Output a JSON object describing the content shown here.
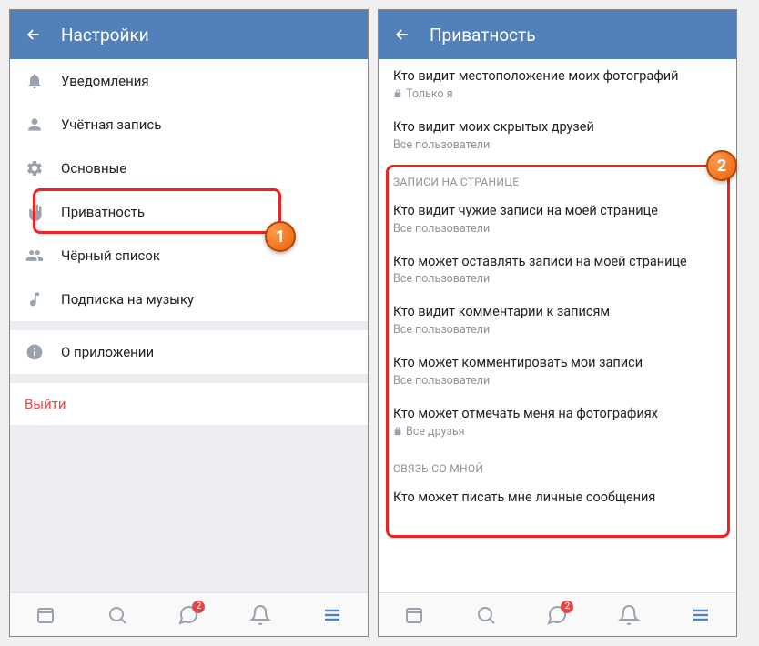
{
  "left": {
    "header": {
      "title": "Настройки"
    },
    "items": [
      {
        "label": "Уведомления"
      },
      {
        "label": "Учётная запись"
      },
      {
        "label": "Основные"
      },
      {
        "label": "Приватность"
      },
      {
        "label": "Чёрный список"
      },
      {
        "label": "Подписка на музыку"
      }
    ],
    "about": {
      "label": "О приложении"
    },
    "logout": {
      "label": "Выйти"
    },
    "badge1": "1"
  },
  "right": {
    "header": {
      "title": "Приватность"
    },
    "top_items": [
      {
        "title": "Кто видит местоположение моих фотографий",
        "sub": "Только я",
        "lock": true
      },
      {
        "title": "Кто видит моих скрытых друзей",
        "sub": "Все пользователи"
      }
    ],
    "section_wall": "ЗАПИСИ НА СТРАНИЦЕ",
    "wall_items": [
      {
        "title": "Кто видит чужие записи на моей странице",
        "sub": "Все пользователи"
      },
      {
        "title": "Кто может оставлять записи на моей странице",
        "sub": "Все пользователи"
      },
      {
        "title": "Кто видит комментарии к записям",
        "sub": "Все пользователи"
      },
      {
        "title": "Кто может комментировать мои записи",
        "sub": "Все пользователи"
      },
      {
        "title": "Кто может отмечать меня на фотографиях",
        "sub": "Все друзья",
        "lock": true
      }
    ],
    "section_contact": "СВЯЗЬ СО МНОЙ",
    "contact_items": [
      {
        "title": "Кто может писать мне личные сообщения"
      }
    ],
    "badge2": "2"
  },
  "nav": {
    "msg_badge": "2"
  }
}
